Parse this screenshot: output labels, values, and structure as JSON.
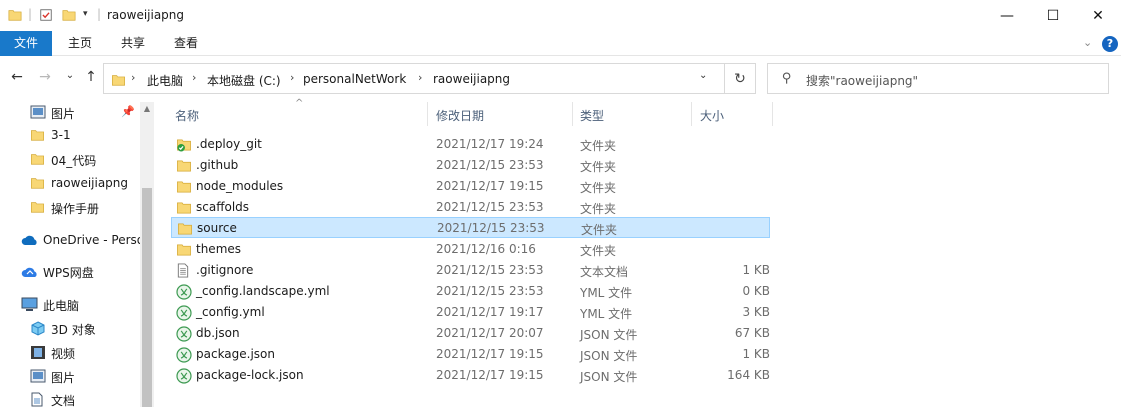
{
  "window": {
    "title": "raoweijiapng",
    "minimize_glyph": "—",
    "maximize_glyph": "☐",
    "close_glyph": "✕"
  },
  "ribbon": {
    "tabs": [
      "文件",
      "主页",
      "共享",
      "查看"
    ],
    "expand_glyph": "⌄",
    "help_glyph": "?"
  },
  "nav": {
    "back_glyph": "←",
    "forward_glyph": "→",
    "recent_glyph": "⌄",
    "up_glyph": "↑"
  },
  "address": {
    "crumbs": [
      "此电脑",
      "本地磁盘 (C:)",
      "personalNetWork",
      "raoweijiapng"
    ],
    "separator": "›",
    "refresh_glyph": "↻"
  },
  "search": {
    "placeholder": "搜索\"raoweijiapng\"",
    "icon": "search-icon"
  },
  "sidebar": {
    "items": [
      {
        "label": "图片",
        "icon": "pictures-icon",
        "pinned": true
      },
      {
        "label": "3-1",
        "icon": "folder-icon"
      },
      {
        "label": "04_代码",
        "icon": "folder-icon"
      },
      {
        "label": "raoweijiapng",
        "icon": "folder-icon"
      },
      {
        "label": "操作手册",
        "icon": "folder-icon"
      },
      {
        "label": "OneDrive - Perso",
        "icon": "onedrive-icon"
      },
      {
        "label": "WPS网盘",
        "icon": "wps-cloud-icon"
      },
      {
        "label": "此电脑",
        "icon": "computer-icon"
      },
      {
        "label": "3D 对象",
        "icon": "3d-objects-icon"
      },
      {
        "label": "视频",
        "icon": "videos-icon"
      },
      {
        "label": "图片",
        "icon": "pictures-icon"
      },
      {
        "label": "文档",
        "icon": "documents-icon"
      }
    ]
  },
  "columns": {
    "name": "名称",
    "date": "修改日期",
    "type": "类型",
    "size": "大小"
  },
  "files": [
    {
      "name": ".deploy_git",
      "date": "2021/12/17 19:24",
      "type": "文件夹",
      "size": "",
      "icon": "folder-synced-icon"
    },
    {
      "name": ".github",
      "date": "2021/12/15 23:53",
      "type": "文件夹",
      "size": "",
      "icon": "folder-icon"
    },
    {
      "name": "node_modules",
      "date": "2021/12/17 19:15",
      "type": "文件夹",
      "size": "",
      "icon": "folder-icon"
    },
    {
      "name": "scaffolds",
      "date": "2021/12/15 23:53",
      "type": "文件夹",
      "size": "",
      "icon": "folder-icon"
    },
    {
      "name": "source",
      "date": "2021/12/15 23:53",
      "type": "文件夹",
      "size": "",
      "icon": "folder-icon",
      "selected": true
    },
    {
      "name": "themes",
      "date": "2021/12/16 0:16",
      "type": "文件夹",
      "size": "",
      "icon": "folder-icon"
    },
    {
      "name": ".gitignore",
      "date": "2021/12/15 23:53",
      "type": "文本文档",
      "size": "1 KB",
      "icon": "text-file-icon"
    },
    {
      "name": "_config.landscape.yml",
      "date": "2021/12/15 23:53",
      "type": "YML 文件",
      "size": "0 KB",
      "icon": "yml-file-icon"
    },
    {
      "name": "_config.yml",
      "date": "2021/12/17 19:17",
      "type": "YML 文件",
      "size": "3 KB",
      "icon": "yml-file-icon"
    },
    {
      "name": "db.json",
      "date": "2021/12/17 20:07",
      "type": "JSON 文件",
      "size": "67 KB",
      "icon": "json-file-icon"
    },
    {
      "name": "package.json",
      "date": "2021/12/17 19:15",
      "type": "JSON 文件",
      "size": "1 KB",
      "icon": "json-file-icon"
    },
    {
      "name": "package-lock.json",
      "date": "2021/12/17 19:15",
      "type": "JSON 文件",
      "size": "164 KB",
      "icon": "json-file-icon"
    }
  ],
  "colors": {
    "accent": "#1979ca",
    "selection": "#cce8ff",
    "folder": "#f8d775"
  }
}
